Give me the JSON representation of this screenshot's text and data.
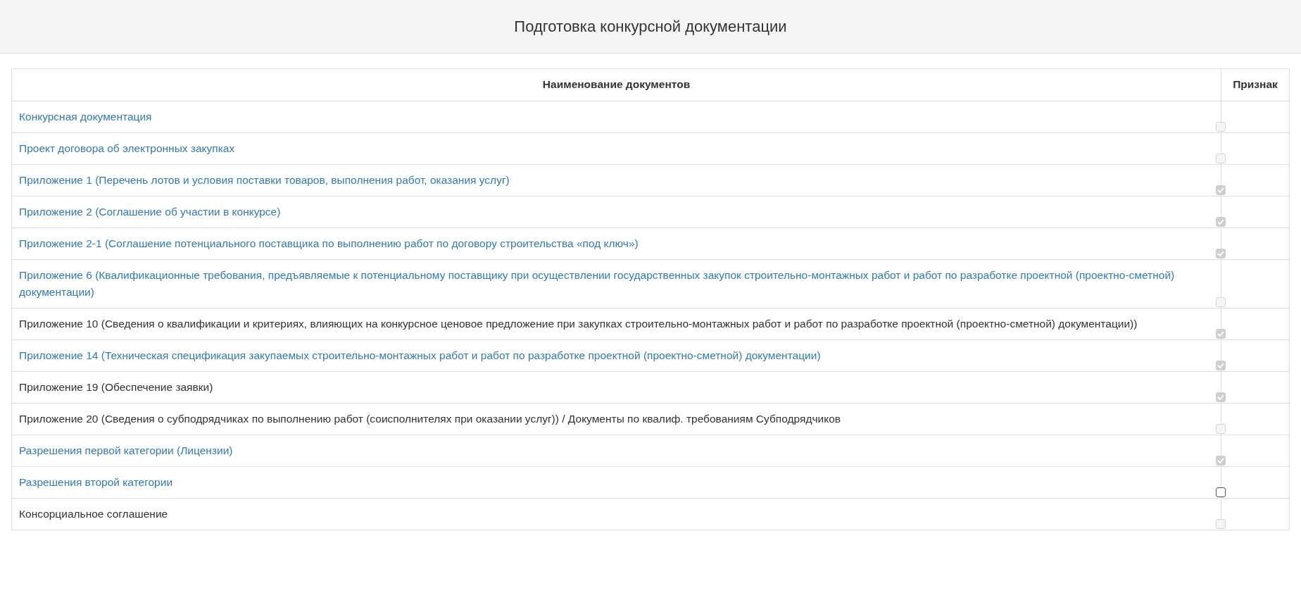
{
  "page_title": "Подготовка конкурсной документации",
  "table": {
    "columns": [
      "Наименование документов",
      "Признак"
    ],
    "rows": [
      {
        "name": "Конкурсная документация",
        "kind": "link",
        "checked": false,
        "disabled": true
      },
      {
        "name": "Проект договора об электронных закупках",
        "kind": "link",
        "checked": false,
        "disabled": true
      },
      {
        "name": "Приложение 1 (Перечень лотов и условия поставки товаров, выполнения работ, оказания услуг)",
        "kind": "link",
        "checked": true,
        "disabled": true
      },
      {
        "name": "Приложение 2 (Соглашение об участии в конкурсе)",
        "kind": "link",
        "checked": true,
        "disabled": true
      },
      {
        "name": "Приложение 2-1 (Соглашение потенциального поставщика по выполнению работ по договору строительства «под ключ»)",
        "kind": "link",
        "checked": true,
        "disabled": true
      },
      {
        "name": "Приложение 6 (Квалификационные требования, предъявляемые к потенциальному поставщику при осуществлении государственных закупок строительно-монтажных работ и работ по разработке проектной (проектно-сметной) документации)",
        "kind": "link",
        "checked": false,
        "disabled": true
      },
      {
        "name": "Приложение 10 (Сведения о квалификации и критериях, влияющих на конкурсное ценовое предложение при закупках строительно-монтажных работ и работ по разработке проектной (проектно-сметной) документации))",
        "kind": "text",
        "checked": true,
        "disabled": true
      },
      {
        "name": "Приложение 14 (Техническая спецификация закупаемых строительно-монтажных работ и работ по разработке проектной (проектно-сметной) документации)",
        "kind": "link",
        "checked": true,
        "disabled": true
      },
      {
        "name": "Приложение 19 (Обеспечение заявки)",
        "kind": "text",
        "checked": true,
        "disabled": true
      },
      {
        "name": "Приложение 20 (Сведения о субподрядчиках по выполнению работ (соисполнителях при оказании услуг)) / Документы по квалиф. требованиям Субподрядчиков",
        "kind": "text",
        "checked": false,
        "disabled": true
      },
      {
        "name": "Разрешения первой категории (Лицензии)",
        "kind": "link",
        "checked": true,
        "disabled": true
      },
      {
        "name": "Разрешения второй категории",
        "kind": "link",
        "checked": false,
        "disabled": false
      },
      {
        "name": "Консорциальное соглашение",
        "kind": "text",
        "checked": false,
        "disabled": true
      }
    ]
  }
}
